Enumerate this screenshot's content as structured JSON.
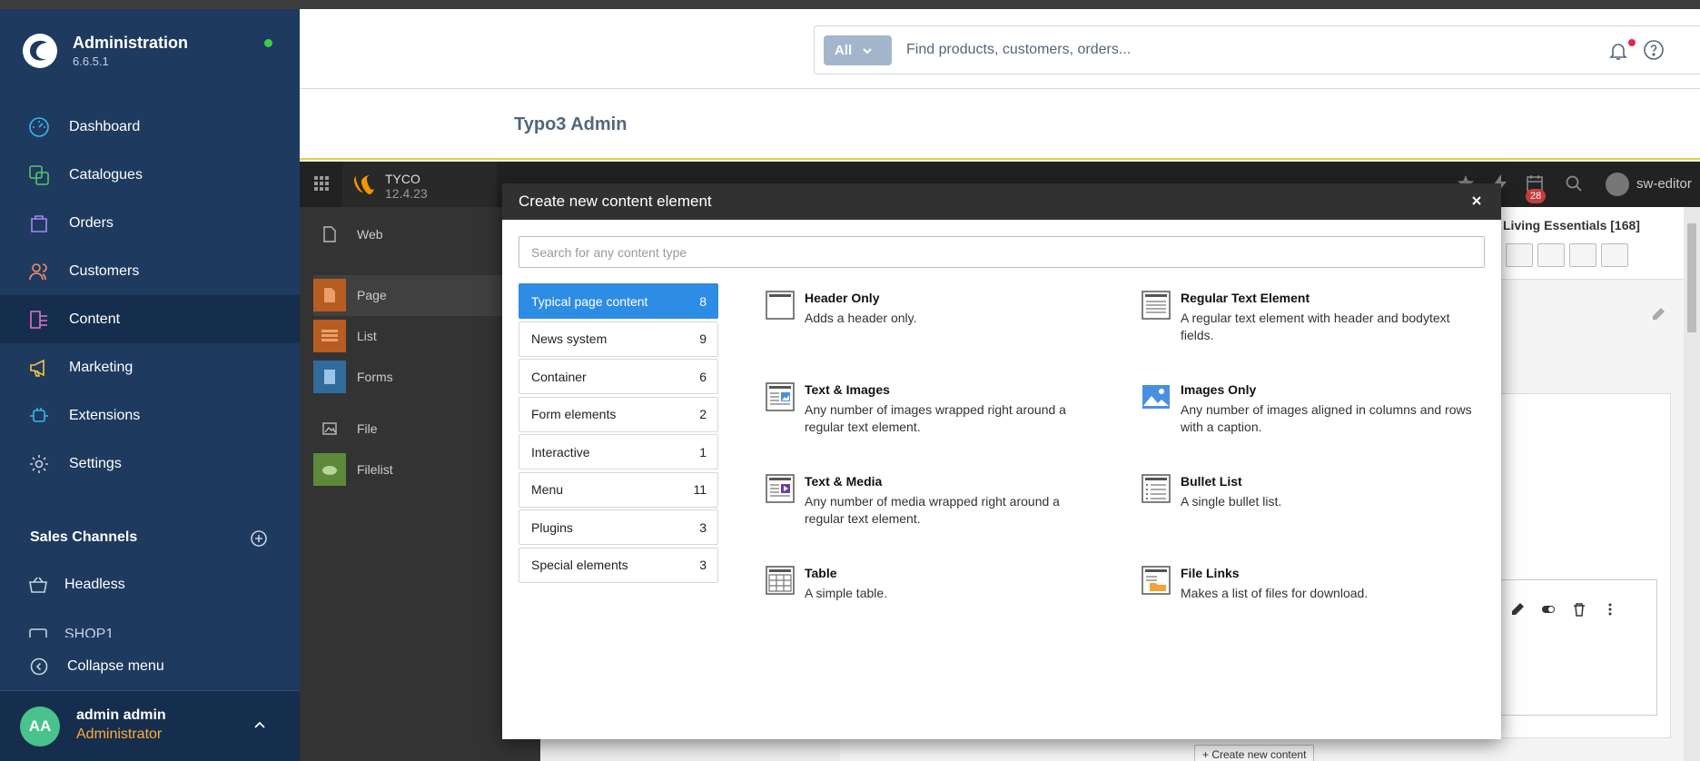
{
  "app": {
    "title": "Administration",
    "version": "6.6.5.1",
    "status_color": "#37d046"
  },
  "sidebar": {
    "items": [
      {
        "label": "Dashboard",
        "icon": "gauge-icon",
        "color": "#3ab6ed",
        "active": false
      },
      {
        "label": "Catalogues",
        "icon": "products-icon",
        "color": "#55c46a",
        "active": false
      },
      {
        "label": "Orders",
        "icon": "shopping-bag-icon",
        "color": "#a886f5",
        "active": false
      },
      {
        "label": "Customers",
        "icon": "users-icon",
        "color": "#f98e6a",
        "active": false
      },
      {
        "label": "Content",
        "icon": "content-icon",
        "color": "#e06fd6",
        "active": true
      },
      {
        "label": "Marketing",
        "icon": "megaphone-icon",
        "color": "#f8c63d",
        "active": false
      },
      {
        "label": "Extensions",
        "icon": "plug-icon",
        "color": "#3ab6ed",
        "active": false
      },
      {
        "label": "Settings",
        "icon": "gear-icon",
        "color": "#c5d2e0",
        "active": false
      }
    ],
    "sales_channels_title": "Sales Channels",
    "sales_channels": [
      {
        "label": "Headless",
        "icon": "basket-icon"
      },
      {
        "label": "SHOP1",
        "icon": "storefront-icon"
      }
    ],
    "collapse_label": "Collapse menu",
    "user": {
      "initials": "AA",
      "name": "admin admin",
      "role": "Administrator"
    }
  },
  "header": {
    "search_scope": "All",
    "search_placeholder": "Find products, customers, orders..."
  },
  "page": {
    "title": "Typo3 Admin"
  },
  "typo3": {
    "site_name": "TYCO",
    "version": "12.4.23",
    "notification_count": "28",
    "username": "sw-editor",
    "modules": [
      {
        "label": "Web",
        "icon": "web-icon"
      },
      {
        "label": "Page",
        "icon": "page-icon"
      },
      {
        "label": "List",
        "icon": "list-icon"
      },
      {
        "label": "Forms",
        "icon": "forms-icon"
      },
      {
        "label": "File",
        "icon": "file-icon"
      },
      {
        "label": "Filelist",
        "icon": "filelist-icon"
      }
    ],
    "page_title": "Living Essentials [168]",
    "create_button": "Create new content"
  },
  "modal": {
    "title": "Create new content element",
    "search_placeholder": "Search for any content type",
    "categories": [
      {
        "label": "Typical page content",
        "count": "8",
        "active": true
      },
      {
        "label": "News system",
        "count": "9",
        "active": false
      },
      {
        "label": "Container",
        "count": "6",
        "active": false
      },
      {
        "label": "Form elements",
        "count": "2",
        "active": false
      },
      {
        "label": "Interactive",
        "count": "1",
        "active": false
      },
      {
        "label": "Menu",
        "count": "11",
        "active": false
      },
      {
        "label": "Plugins",
        "count": "3",
        "active": false
      },
      {
        "label": "Special elements",
        "count": "3",
        "active": false
      }
    ],
    "elements": [
      {
        "title": "Header Only",
        "desc": "Adds a header only.",
        "icon": "header-only-icon"
      },
      {
        "title": "Regular Text Element",
        "desc": "A regular text element with header and bodytext fields.",
        "icon": "text-element-icon"
      },
      {
        "title": "Text & Images",
        "desc": "Any number of images wrapped right around a regular text element.",
        "icon": "text-images-icon"
      },
      {
        "title": "Images Only",
        "desc": "Any number of images aligned in columns and rows with a caption.",
        "icon": "images-only-icon"
      },
      {
        "title": "Text & Media",
        "desc": "Any number of media wrapped right around a regular text element.",
        "icon": "text-media-icon"
      },
      {
        "title": "Bullet List",
        "desc": "A single bullet list.",
        "icon": "bullet-list-icon"
      },
      {
        "title": "Table",
        "desc": "A simple table.",
        "icon": "table-icon"
      },
      {
        "title": "File Links",
        "desc": "Makes a list of files for download.",
        "icon": "file-links-icon"
      }
    ]
  },
  "colors": {
    "sidebar_bg": "#1e3a5f",
    "accent_blue": "#2d8ce4",
    "modal_header": "#313131"
  }
}
